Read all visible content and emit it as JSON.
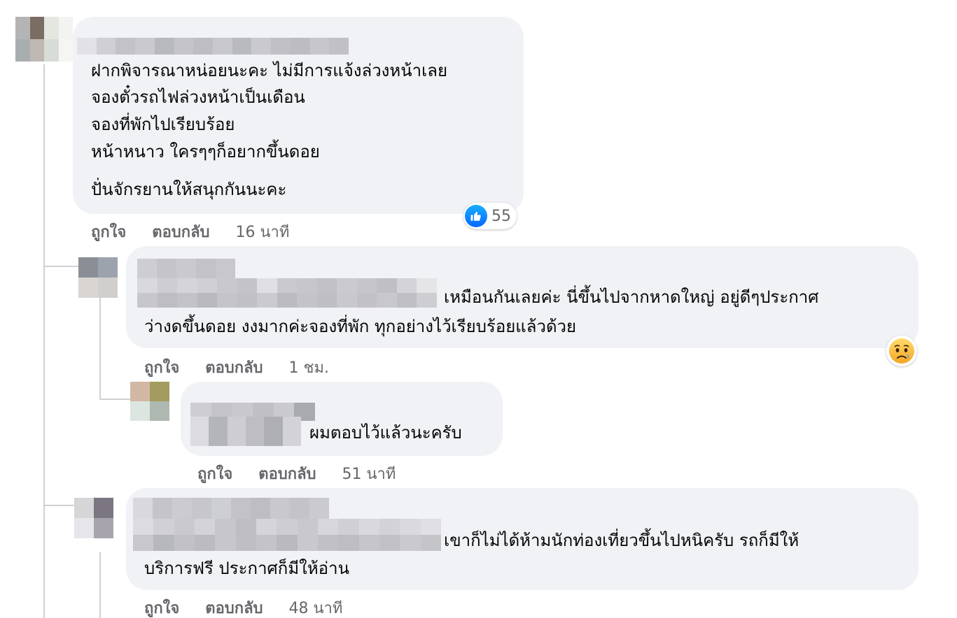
{
  "colors": {
    "bubble": "#f0f2f5",
    "meta_text": "#65676b",
    "like_blue": "#0866ff",
    "thread_line": "#ced0d4"
  },
  "comments": [
    {
      "lines": [
        "ฝากพิจารณาหน่อยนะคะ ไม่มีการแจ้งล่วงหน้าเลย",
        "จองตั๋วรถไฟล่วงหน้าเป็นเดือน",
        "จองที่พักไปเรียบร้อย",
        "หน้าหนาว ใครๆๆก็อยากขึ้นดอย",
        "ปั่นจักรยานให้สนุกกันนะคะ"
      ],
      "like_label": "ถูกใจ",
      "reply_label": "ตอบกลับ",
      "time": "16 นาที",
      "reaction_icon": "like-icon",
      "reaction_count": "55"
    },
    {
      "lines": [
        "เหมือนกันเลยค่ะ นี่ขึ้นไปจากหาดใหญ่ อยู่ดีๆประกาศ",
        "ว่างดขึ้นดอย งงมากค่ะจองที่พัก ทุกอย่างไว้เรียบร้อยแล้วด้วย"
      ],
      "like_label": "ถูกใจ",
      "reply_label": "ตอบกลับ",
      "time": "1 ชม.",
      "reaction_icon": "sad-icon"
    },
    {
      "lines": [
        "ผมตอบไว้แล้วนะครับ"
      ],
      "like_label": "ถูกใจ",
      "reply_label": "ตอบกลับ",
      "time": "51 นาที"
    },
    {
      "lines": [
        "เขาก็ไม่ได้ห้ามนักท่องเที่ยวขึ้นไปหนิครับ รถก็มีให้",
        "บริการฟรี ประกาศก็มีให้อ่าน"
      ],
      "like_label": "ถูกใจ",
      "reply_label": "ตอบกลับ",
      "time": "48 นาที"
    }
  ]
}
